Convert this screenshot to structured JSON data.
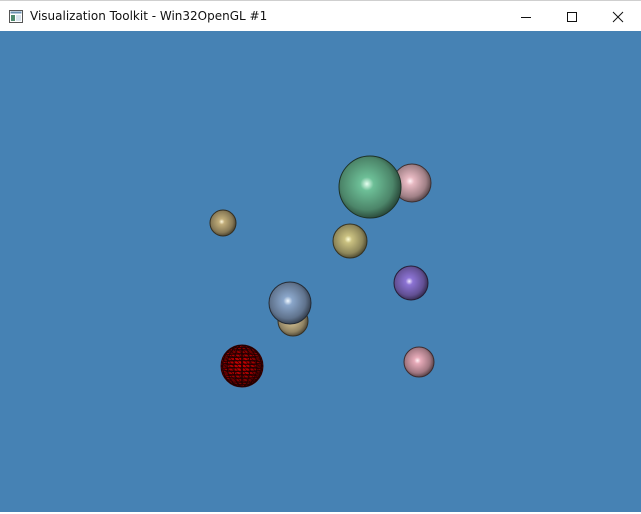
{
  "window": {
    "title": "Visualization Toolkit - Win32OpenGL #1",
    "icons": {
      "app": "vtk-window-icon",
      "minimize": "minimize-icon",
      "maximize": "maximize-icon",
      "close": "close-icon"
    }
  },
  "scene": {
    "background": "#4682b4",
    "spheres": [
      {
        "id": "sphere-large-green",
        "color": "#5fa683",
        "highlight": "#e6fff0",
        "wireframe": false
      },
      {
        "id": "sphere-pink-upper",
        "color": "#c8a0a8",
        "highlight": "#fff0f4",
        "wireframe": false
      },
      {
        "id": "sphere-tan-left",
        "color": "#a8966a",
        "highlight": "#fff8dc",
        "wireframe": false
      },
      {
        "id": "sphere-yellow-center",
        "color": "#b0a870",
        "highlight": "#ffffd8",
        "wireframe": false
      },
      {
        "id": "sphere-purple",
        "color": "#7a64b8",
        "highlight": "#f0e6ff",
        "wireframe": false
      },
      {
        "id": "sphere-blue-gray",
        "color": "#7890b0",
        "highlight": "#f0f8ff",
        "wireframe": false
      },
      {
        "id": "sphere-tan-behind",
        "color": "#b4a47c",
        "highlight": "#fff6dc",
        "wireframe": false
      },
      {
        "id": "sphere-red-wireframe",
        "color": "#d00000",
        "highlight": "#ff4040",
        "wireframe": true
      },
      {
        "id": "sphere-pink-lower",
        "color": "#c894a0",
        "highlight": "#fff0f4",
        "wireframe": false
      }
    ]
  }
}
